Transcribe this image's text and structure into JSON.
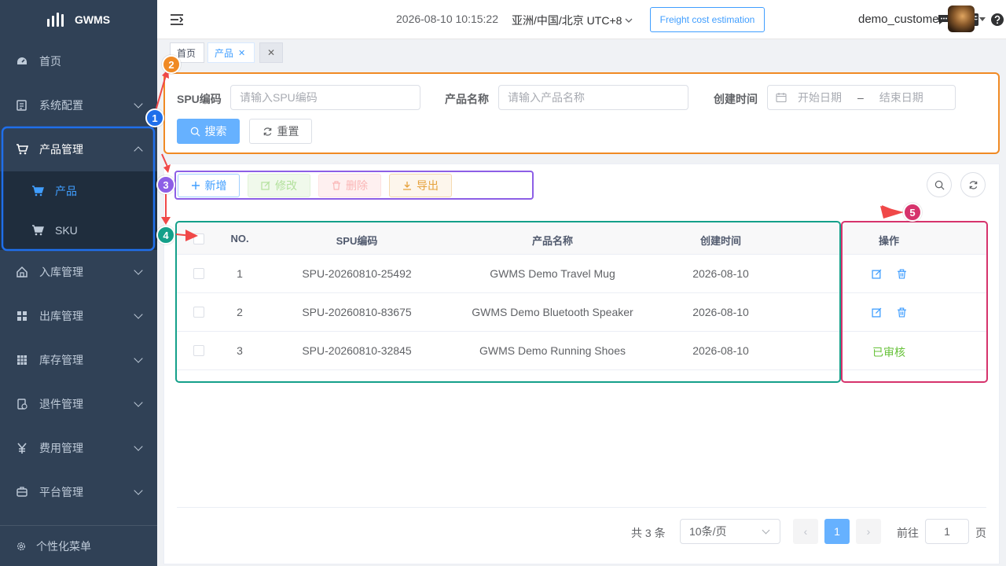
{
  "sidebar": {
    "brand": "GWMS",
    "items": [
      {
        "label": "首页",
        "icon": "dashboard-icon"
      },
      {
        "label": "系统配置",
        "icon": "system-config-icon"
      },
      {
        "label": "产品管理",
        "icon": "cart-icon"
      },
      {
        "label": "入库管理",
        "icon": "home-inbound-icon"
      },
      {
        "label": "出库管理",
        "icon": "grid-outbound-icon"
      },
      {
        "label": "库存管理",
        "icon": "table-inventory-icon"
      },
      {
        "label": "退件管理",
        "icon": "returns-icon"
      },
      {
        "label": "费用管理",
        "icon": "yen-icon"
      },
      {
        "label": "平台管理",
        "icon": "platform-icon"
      }
    ],
    "sub_items": [
      {
        "label": "产品"
      },
      {
        "label": "SKU"
      }
    ],
    "footer": "个性化菜单"
  },
  "header": {
    "datetime": "2026-08-10 10:15:22",
    "timezone": "亚洲/中国/北京 UTC+8",
    "freight_btn": "Freight cost estimation",
    "username": "demo_customer"
  },
  "tags": {
    "home": "首页",
    "active": "产品"
  },
  "search": {
    "spu_label": "SPU编码",
    "spu_placeholder": "请输入SPU编码",
    "name_label": "产品名称",
    "name_placeholder": "请输入产品名称",
    "time_label": "创建时间",
    "start_placeholder": "开始日期",
    "range_sep": "–",
    "end_placeholder": "结束日期",
    "search_btn": "搜索",
    "reset_btn": "重置"
  },
  "toolbar": {
    "add": "新增",
    "edit": "修改",
    "delete": "删除",
    "export": "导出"
  },
  "table": {
    "headers": {
      "no": "NO.",
      "spu": "SPU编码",
      "name": "产品名称",
      "created": "创建时间",
      "ops": "操作"
    },
    "rows": [
      {
        "no": "1",
        "spu": "SPU-20260810-25492",
        "name": "GWMS Demo Travel Mug",
        "created": "2026-08-10",
        "status": ""
      },
      {
        "no": "2",
        "spu": "SPU-20260810-83675",
        "name": "GWMS Demo Bluetooth Speaker",
        "created": "2026-08-10",
        "status": ""
      },
      {
        "no": "3",
        "spu": "SPU-20260810-32845",
        "name": "GWMS Demo Running Shoes",
        "created": "2026-08-10",
        "status": "已审核"
      }
    ]
  },
  "pagination": {
    "total": "共 3 条",
    "page_size": "10条/页",
    "current": "1",
    "goto_label": "前往",
    "goto_value": "1",
    "page_suffix": "页"
  },
  "annotations": {
    "b1": "1",
    "b2": "2",
    "b3": "3",
    "b4": "4",
    "b5": "5",
    "colors": {
      "blue": "#1f6feb",
      "orange": "#f08a24",
      "purple": "#8d5fe6",
      "teal": "#14a08a",
      "pink": "#d6336c"
    }
  }
}
